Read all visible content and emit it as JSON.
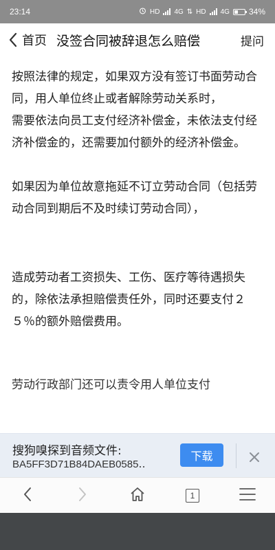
{
  "status_bar": {
    "time": "23:14",
    "indicators": "HD 4G HD 4G",
    "battery": "34%",
    "battery_level": 0.34
  },
  "header": {
    "back_label": "首页",
    "title": "没签合同被辞退怎么赔偿",
    "ask_label": "提问"
  },
  "article": {
    "paragraphs": [
      "按照法律的规定，如果双方没有签订书面劳动合同，用人单位终止或者解除劳动关系时，",
      "需要依法向员工支付经济补偿金，未依法支付经济补偿金的，还需要加付额外的经济补偿金。",
      "如果因为单位故意拖延不订立劳动合同（包括劳动合同到期后不及时续订劳动合同），",
      "造成劳动者工资损失、工伤、医疗等待遇损失的，除依法承担赔偿责任外，同时还要支付２５％的额外赔偿费用。",
      "劳动行政部门还可以责令用人单位支付"
    ]
  },
  "download_bar": {
    "title": "搜狗嗅探到音频文件:",
    "file_name": "BA5FF3D71B84DAEB0585‥",
    "button_label": "下载"
  },
  "toolbar": {
    "tab_count": "1"
  },
  "colors": {
    "status_bar": "#8c8c8c",
    "download_bar": "#e9eef5",
    "download_button": "#3d8cf0",
    "nav_area": "#444749"
  }
}
